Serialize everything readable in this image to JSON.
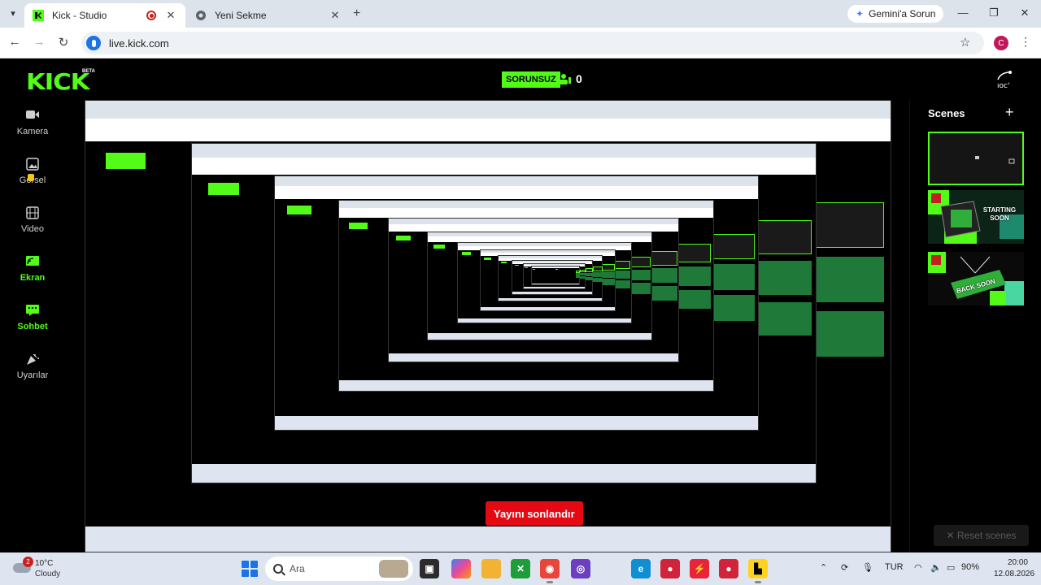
{
  "browser": {
    "tabs": [
      {
        "label": "Kick - Studio",
        "active": true,
        "recording": true
      },
      {
        "label": "Yeni Sekme",
        "active": false
      }
    ],
    "gemini_button": "Gemini'a Sorun",
    "url": "live.kick.com",
    "profile_initial": "C"
  },
  "studio": {
    "logo": "KICK",
    "logo_badge": "BETA",
    "status": "SORUNSUZ",
    "viewer_count": "0",
    "sidebar": [
      {
        "label": "Kamera",
        "icon": "camera-icon",
        "active": false
      },
      {
        "label": "Görsel",
        "icon": "image-icon",
        "active": false
      },
      {
        "label": "Video",
        "icon": "film-icon",
        "active": false
      },
      {
        "label": "Ekran",
        "icon": "screen-cast-icon",
        "active": true
      },
      {
        "label": "Sohbet",
        "icon": "chat-icon",
        "active": true
      },
      {
        "label": "Uyarılar",
        "icon": "party-icon",
        "active": false
      }
    ],
    "end_stream_button": "Yayını sonlandır",
    "scenes": {
      "title": "Scenes",
      "items": [
        {
          "label": "",
          "active": true
        },
        {
          "label": "STARTING SOON",
          "active": false
        },
        {
          "label": "BACK SOON",
          "active": false
        }
      ],
      "reset_button": "✕ Reset scenes"
    }
  },
  "taskbar": {
    "weather": {
      "badge": "2",
      "temp": "10°C",
      "condition": "Cloudy"
    },
    "search_placeholder": "Ara",
    "language": "TUR",
    "battery": "90%",
    "time": "20:00",
    "date": "12.08.2026"
  },
  "colors": {
    "kick_green": "#53fc18",
    "danger": "#e50914",
    "taskbar": "#dfe5f0"
  }
}
